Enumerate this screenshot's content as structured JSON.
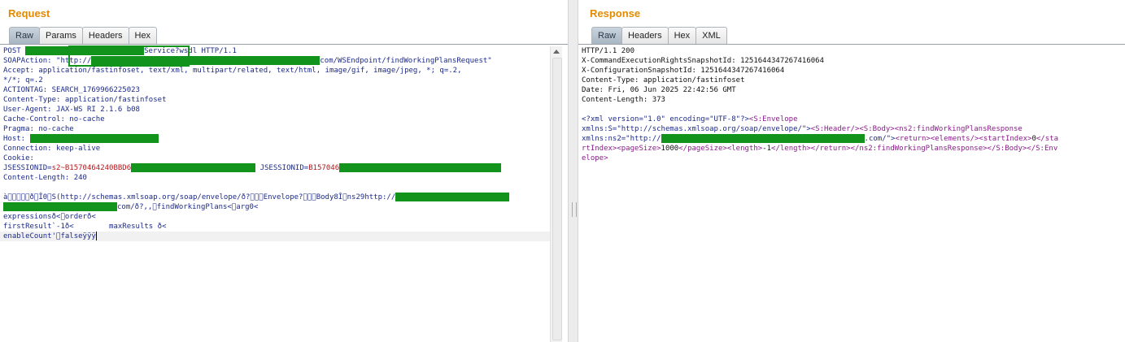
{
  "request": {
    "title": "Request",
    "tabs": [
      "Raw",
      "Params",
      "Headers",
      "Hex"
    ],
    "active_tab": "Raw",
    "lines": {
      "l1a": "POST ",
      "l1b": "Service?wsdl HTTP/1.1",
      "l2a": "SOAPAction: \"http://",
      "l2b": "com/WSEndpoint/findWorkingPlansRequest\"",
      "l3": "Accept: application/fastinfoset, text/xml, multipart/related, text/html, image/gif, image/jpeg, *; q=.2,",
      "l4": "*/*; q=.2",
      "l5": "ACTIONTAG: SEARCH_1769966225023",
      "l6": "Content-Type: application/fastinfoset",
      "l7": "User-Agent: JAX-WS RI 2.1.6 b08",
      "l8": "Cache-Control: no-cache",
      "l9": "Pragma: no-cache",
      "l10a": "Host: ",
      "l11": "Connection: keep-alive",
      "l12": "Cookie:",
      "l13a": "JSESSIONID=",
      "l13b": "s2~B1570464240BBD6",
      "l13c": " JSESSIONID=",
      "l13d": "B157046",
      "l14": "Content-Length: 240",
      "l16a": "à\u0000\u0000\u0000\u0000\u0000ð\u0000Î0\u0000S(http://schemas.xmlsoap.org/soap/envelope/ð?\u0000\u0000\u0000Envelope?\u0000\u0000\u0000Body8Î\u0000ns29http://",
      "l17a": "com/ð?,,\u0000findWorkingPlans<\u0000arg0<",
      "l18": "expressionsð<\u0000orderð<",
      "l19": "firstResult`-1ð<        maxResults ð<",
      "l20": "enableCount'\u0000falseÿÿÿ"
    }
  },
  "response": {
    "title": "Response",
    "tabs": [
      "Raw",
      "Headers",
      "Hex",
      "XML"
    ],
    "active_tab": "Raw",
    "lines": {
      "r1": "HTTP/1.1 200",
      "r2": "X-CommandExecutionRightsSnapshotId: 1251644347267416064",
      "r3": "X-ConfigurationSnapshotId: 1251644347267416064",
      "r4": "Content-Type: application/fastinfoset",
      "r5": "Date: Fri, 06 Jun 2025 22:42:56 GMT",
      "r6": "Content-Length: 373",
      "r8a": "<?xml version=\"1.0\" encoding=\"UTF-8\"?>",
      "r8b": "<S:Envelope",
      "r9a": "xmlns:S=\"http://schemas.xmlsoap.org/soap/envelope/\">",
      "r9b": "<S:Header/><S:Body><ns2:findWorkingPlansResponse",
      "r10a": "xmlns:ns2=\"http://",
      "r10b": ".com/\">",
      "r10c": "<return><elements/><startIndex>",
      "r10d": "0",
      "r10e": "</sta",
      "r11a": "rtIndex><pageSize>",
      "r11b": "1000",
      "r11c": "</pageSize><length>",
      "r11d": "-1",
      "r11e": "</length></return></ns2:findWorkingPlansResponse></S:Body></S:Env",
      "r12": "elope>"
    }
  }
}
